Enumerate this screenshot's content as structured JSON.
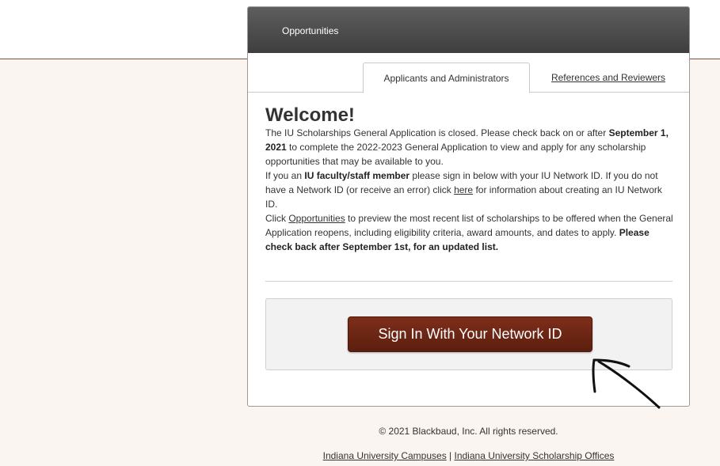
{
  "header": {
    "opportunities_label": "Opportunities"
  },
  "tabs": [
    {
      "label": "Applicants and Administrators",
      "active": true
    },
    {
      "label": "References and Reviewers",
      "active": false
    }
  ],
  "welcome": {
    "title": "Welcome!",
    "p1_a": "The IU Scholarships General Application is closed. Please check back on or after ",
    "p1_bold": "September 1, 2021",
    "p1_b": " to complete the 2022-2023 General Application to view and apply for any scholarship opportunities that may be available to you.",
    "p2_a": "If you an ",
    "p2_bold": "IU faculty/staff member",
    "p2_b": " please sign in below with your IU Network ID. If you do not have a Network ID (or receive an error) click ",
    "p2_link": "here",
    "p2_c": " for information about creating an IU Network ID.",
    "p3_a": "Click ",
    "p3_link": "Opportunities",
    "p3_b": " to preview the most recent list of scholarships to be offered when the General Application reopens, including eligibility criteria, award amounts, and dates to apply. ",
    "p3_bold": "Please check back after September 1st, for an updated list."
  },
  "signin": {
    "button_label": "Sign In With Your Network ID"
  },
  "footer": {
    "copyright": "© 2021 Blackbaud, Inc. All rights reserved.",
    "link1": "Indiana University Campuses",
    "separator": " | ",
    "link2": "Indiana University Scholarship Offices"
  },
  "colors": {
    "button": "#6e2615",
    "header_bar": "#4a4a4a",
    "page_background": "#fbf5f1"
  }
}
